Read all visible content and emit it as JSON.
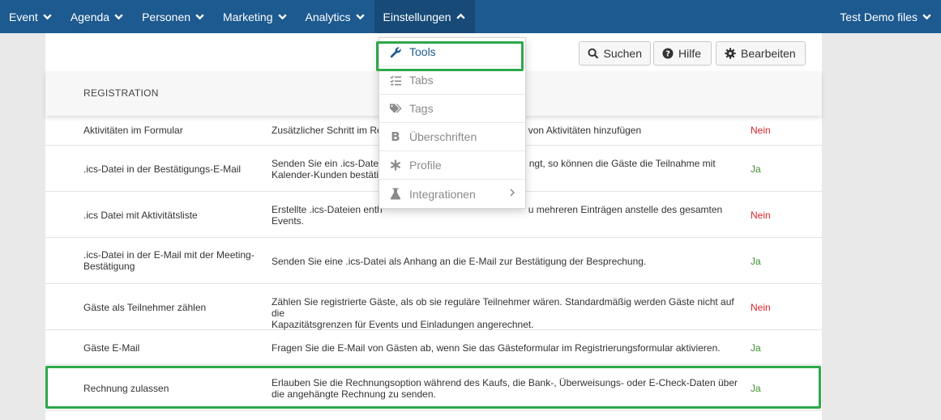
{
  "nav": {
    "items": [
      {
        "label": "Event"
      },
      {
        "label": "Agenda"
      },
      {
        "label": "Personen"
      },
      {
        "label": "Marketing"
      },
      {
        "label": "Analytics"
      },
      {
        "label": "Einstellungen"
      }
    ],
    "right_label": "Test Demo files"
  },
  "toolbar": {
    "search_label": "Suchen",
    "help_label": "Hilfe",
    "edit_label": "Bearbeiten"
  },
  "section": {
    "title": "REGISTRATION"
  },
  "dropdown": {
    "items": [
      {
        "label": "Tools",
        "icon": "wrench-icon"
      },
      {
        "label": "Tabs",
        "icon": "checklist-icon"
      },
      {
        "label": "Tags",
        "icon": "tags-icon"
      },
      {
        "label": "Überschriften",
        "icon": "bold-icon"
      },
      {
        "label": "Profile",
        "icon": "asterisk-icon"
      },
      {
        "label": "Integrationen",
        "icon": "flask-icon"
      }
    ]
  },
  "rows": [
    {
      "name": "Aktivitäten im Formular",
      "desc": "Zusätzlicher Schritt im Re",
      "desc_tail": "von Aktivitäten hinzufügen",
      "value": "Nein"
    },
    {
      "name": ".ics-Datei in der Bestätigungs-E-Mail",
      "desc": "Senden Sie ein .ics-Datei",
      "desc_tail": "ngt, so können die Gäste die Teilnahme mit",
      "desc2": "Kalender-Kunden bestäti",
      "value": "Ja"
    },
    {
      "name": ".ics Datei mit Aktivitätsliste",
      "desc": "Erstellte .ics-Dateien enth",
      "desc_tail": "u mehreren Einträgen anstelle des gesamten",
      "desc2": "Events.",
      "value": "Nein"
    },
    {
      "name": ".ics-Datei in der E-Mail mit der Meeting-",
      "name2": "Bestätigung",
      "desc": "Senden Sie eine .ics-Datei als Anhang an die E-Mail zur Bestätigung der Besprechung.",
      "value": "Ja"
    },
    {
      "name": "Gäste als Teilnehmer zählen",
      "desc": "Zählen Sie registrierte Gäste, als ob sie reguläre Teilnehmer wären. Standardmäßig werden Gäste nicht auf die",
      "desc2": "Kapazitätsgrenzen für Events und Einladungen angerechnet.",
      "value": "Nein"
    },
    {
      "name": "Gäste E-Mail",
      "desc": "Fragen Sie die E-Mail von Gästen ab, wenn Sie das Gästeformular im Registrierungsformular aktivieren.",
      "value": "Ja"
    },
    {
      "name": "Rechnung zulassen",
      "desc": "Erlauben Sie die Rechnungsoption während des Kaufs, die Bank-, Überweisungs- oder E-Check-Daten über",
      "desc2": "die angehängte Rechnung zu senden.",
      "value": "Ja"
    }
  ],
  "colors": {
    "nav_bg": "#1c5a8f",
    "yes": "#3f8f2f",
    "no": "#d9262a",
    "highlight": "#2ea84a"
  }
}
